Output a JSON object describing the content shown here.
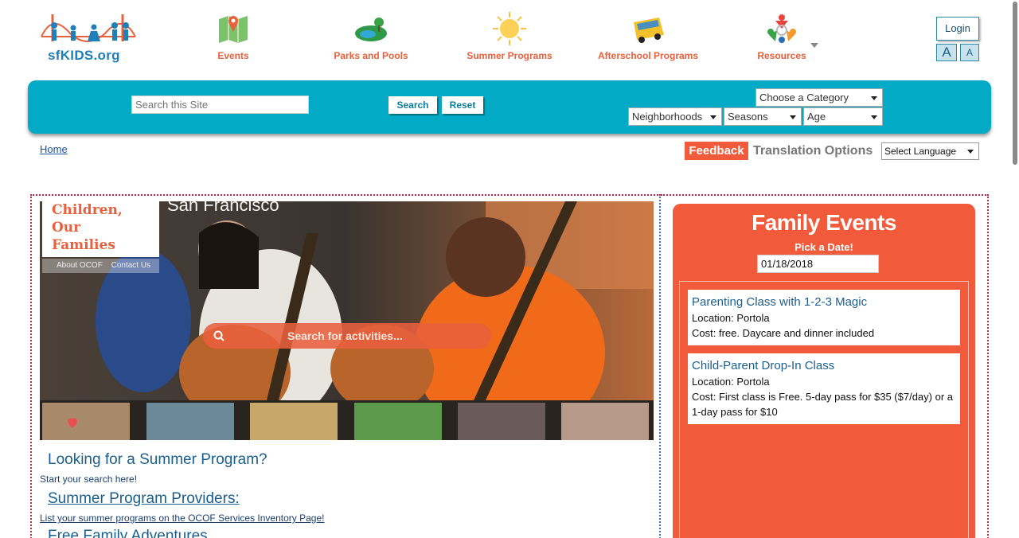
{
  "header": {
    "logo_text": "sfKIDS.org",
    "nav": [
      {
        "label": "Events",
        "icon": "map-icon"
      },
      {
        "label": "Parks and Pools",
        "icon": "park-icon"
      },
      {
        "label": "Summer Programs",
        "icon": "sun-icon"
      },
      {
        "label": "Afterschool Programs",
        "icon": "school-bus-icon"
      },
      {
        "label": "Resources",
        "icon": "people-circle-icon"
      }
    ],
    "login_label": "Login",
    "font_increase": "A",
    "font_decrease": "A"
  },
  "search": {
    "placeholder": "Search this Site",
    "search_label": "Search",
    "reset_label": "Reset",
    "category": "Choose a Category",
    "neighborhoods": "Neighborhoods",
    "seasons": "Seasons",
    "age": "Age"
  },
  "breadcrumb": {
    "home": "Home"
  },
  "utility": {
    "feedback": "Feedback",
    "translation": "Translation Options",
    "language": "Select Language"
  },
  "hero": {
    "logo_line1": "Children,",
    "logo_line2": "Our",
    "logo_line3": "Families",
    "about_link": "About OCOF",
    "contact_link": "Contact Us",
    "title_partial": "San Francisco",
    "search_placeholder": "Search for activities..."
  },
  "content": {
    "summer_title": "Looking for a Summer Program?",
    "summer_sub": "Start your search here!",
    "providers_title": "Summer Program Providers:",
    "providers_sub": "List your summer programs on the OCOF Services Inventory Page!",
    "free_title": "Free Family Adventures"
  },
  "events": {
    "title": "Family Events",
    "pick_date": "Pick a Date!",
    "date_value": "01/18/2018",
    "items": [
      {
        "title": "Parenting Class with 1-2-3 Magic",
        "location": "Location: Portola",
        "cost": "Cost: free. Daycare and dinner included"
      },
      {
        "title": "Child-Parent Drop-In Class",
        "location": "Location: Portola",
        "cost": "Cost: First class is Free. 5-day pass for $35 ($7/day) or a 1-day pass for $10"
      }
    ]
  },
  "colors": {
    "accent_teal": "#02aac6",
    "accent_orange": "#f15a3a",
    "link_blue": "#1a5f8e"
  }
}
